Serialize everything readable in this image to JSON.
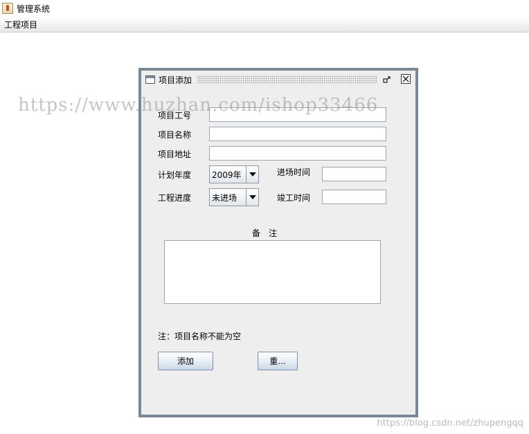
{
  "app": {
    "title": "管理系统"
  },
  "menu": {
    "items": [
      "工程项目"
    ]
  },
  "frame": {
    "title": "项目添加",
    "fields": {
      "project_code_label": "项目工号",
      "project_name_label": "项目名称",
      "project_address_label": "项目地址",
      "plan_year_label": "计划年度",
      "plan_year_value": "2009年",
      "entry_time_label": "进场时间",
      "progress_label": "工程进度",
      "progress_value": "未进场",
      "completion_time_label": "竣工时间"
    },
    "remarks_label": "备　注",
    "note": "注：项目名称不能为空",
    "add_button": "添加",
    "reset_button": "重..."
  },
  "watermarks": {
    "main": "https://www.huzhan.com/ishop33466",
    "corner": "https://blog.csdn.net/zhupengqq"
  }
}
